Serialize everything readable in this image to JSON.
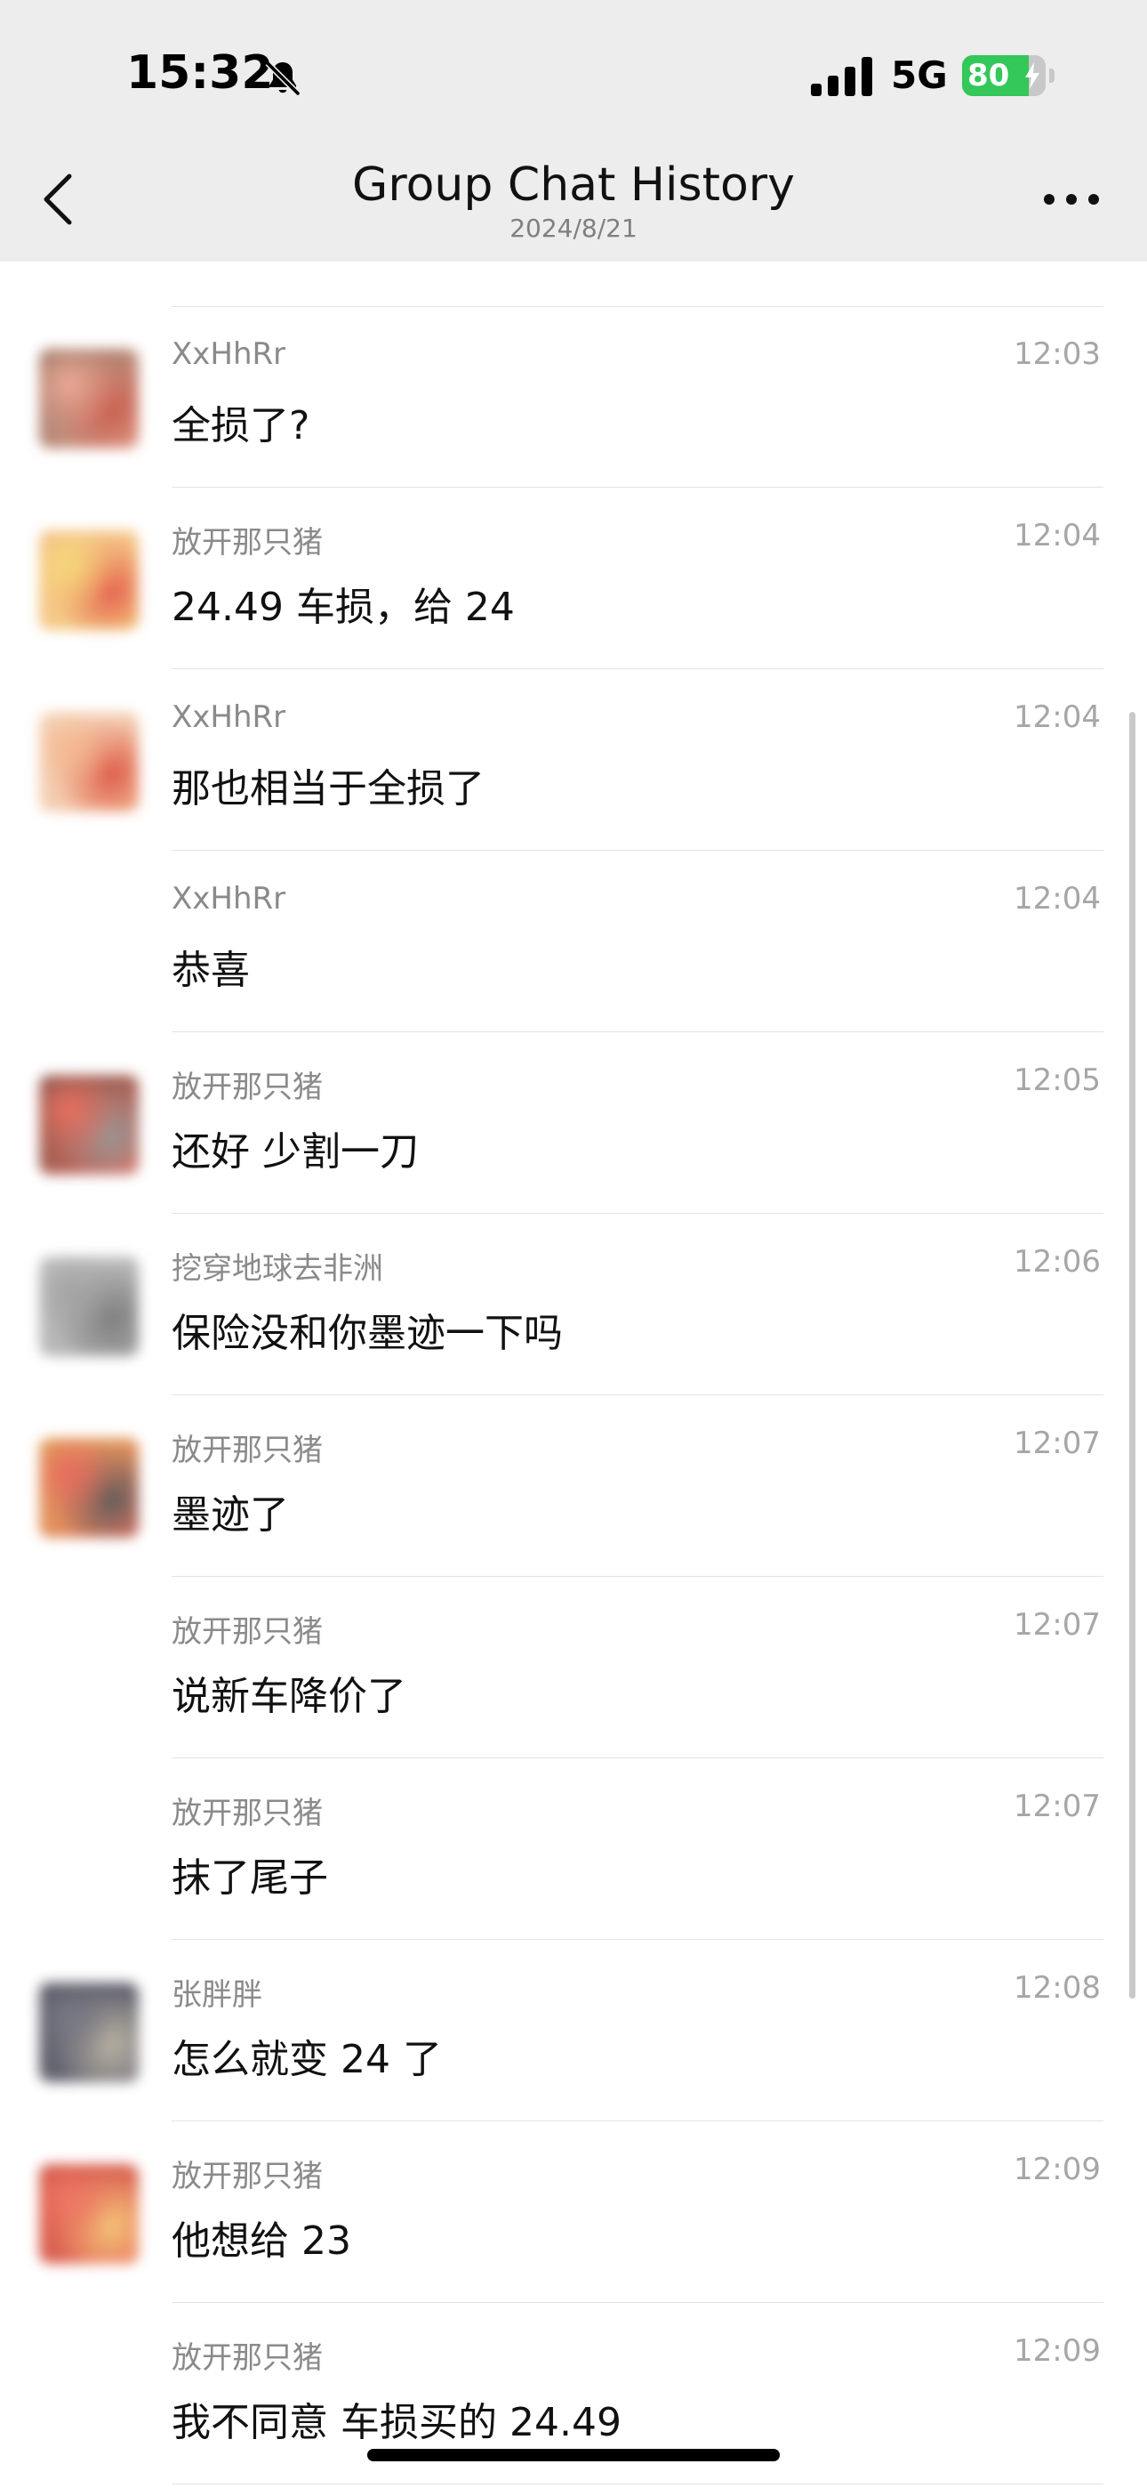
{
  "status_bar": {
    "time": "15:32",
    "network": "5G",
    "battery_percent": "80",
    "battery_level": 0.8,
    "icons": [
      "bell-off-icon",
      "signal-icon",
      "battery-icon",
      "bolt-icon"
    ]
  },
  "header": {
    "title": "Group Chat History",
    "subtitle": "2024/8/21",
    "back_icon": "chevron-left-icon",
    "more_icon": "more-horizontal-icon"
  },
  "colors": {
    "header_bg": "#ededed",
    "battery_green": "#34c759",
    "sender_gray": "#8a8a8a",
    "time_gray": "#a6a6a6"
  },
  "messages": [
    {
      "sender": "XxHhRr",
      "time": "12:03",
      "text": "全损了?",
      "avatar_colors": [
        "#e9a08a",
        "#c44b3a",
        "#7c5b4a"
      ]
    },
    {
      "sender": "放开那只猪",
      "time": "12:04",
      "text": "24.49 车损，给 24",
      "avatar_colors": [
        "#f5d36a",
        "#e24b3b",
        "#f3b08a"
      ]
    },
    {
      "sender": "XxHhRr",
      "time": "12:04",
      "text": "那也相当于全损了",
      "avatar_colors": [
        "#f4b183",
        "#d9442f",
        "#f0e0d0"
      ]
    },
    {
      "sender": "XxHhRr",
      "time": "12:04",
      "text": "恭喜",
      "avatar_colors": []
    },
    {
      "sender": "放开那只猪",
      "time": "12:05",
      "text": "还好 少割一刀",
      "avatar_colors": [
        "#e8604f",
        "#8b8b8b",
        "#5a4035"
      ]
    },
    {
      "sender": "挖穿地球去非洲",
      "time": "12:06",
      "text": "保险没和你墨迹一下吗",
      "avatar_colors": [
        "#9a9a9a",
        "#6f6f6f",
        "#c8c8c8"
      ]
    },
    {
      "sender": "放开那只猪",
      "time": "12:07",
      "text": "墨迹了",
      "avatar_colors": [
        "#e65a4d",
        "#4a4a4a",
        "#d9b14a"
      ]
    },
    {
      "sender": "放开那只猪",
      "time": "12:07",
      "text": "说新车降价了",
      "avatar_colors": []
    },
    {
      "sender": "放开那只猪",
      "time": "12:07",
      "text": "抹了尾子",
      "avatar_colors": []
    },
    {
      "sender": "张胖胖",
      "time": "12:08",
      "text": "怎么就变 24 了",
      "avatar_colors": [
        "#6b6b78",
        "#b7ae9a",
        "#3a3a48"
      ]
    },
    {
      "sender": "放开那只猪",
      "time": "12:09",
      "text": "他想给 23",
      "avatar_colors": [
        "#ee6a55",
        "#f4c36a",
        "#c0392b"
      ]
    },
    {
      "sender": "放开那只猪",
      "time": "12:09",
      "text": "我不同意 车损买的 24.49",
      "avatar_colors": []
    }
  ]
}
